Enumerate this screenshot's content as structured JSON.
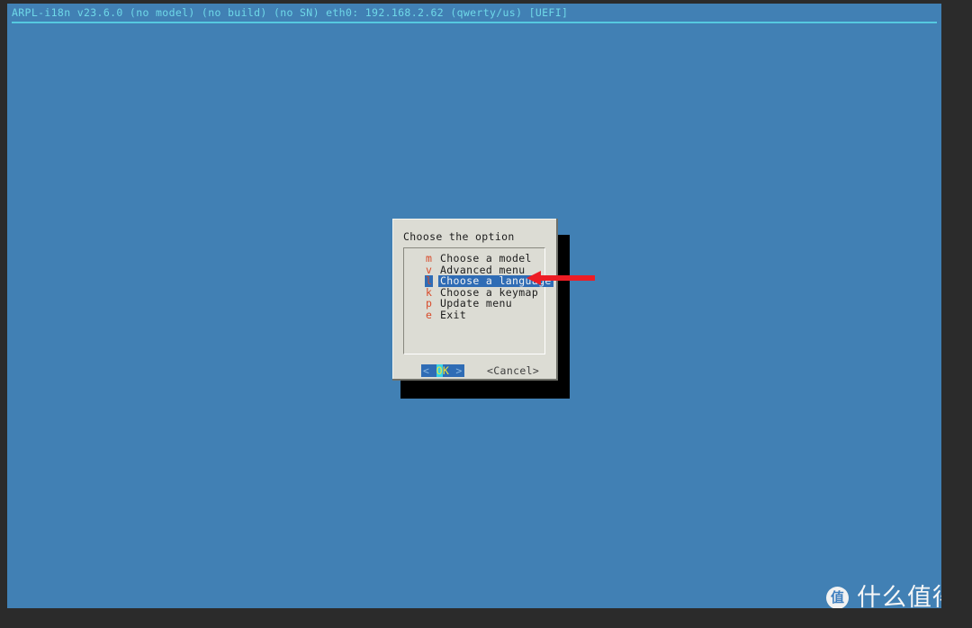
{
  "screen": {
    "background_color": "#2b2b2b",
    "console_color": "#4180b4"
  },
  "status_bar": {
    "text": "ARPL-i18n v23.6.0 (no model) (no build) (no SN) eth0: 192.168.2.62 (qwerty/us) [UEFI]",
    "text_color": "#6fd8e8",
    "rule_color": "#55c9e0"
  },
  "dialog": {
    "title": "Choose the option",
    "background_color": "#dcdcd4",
    "menu": {
      "items": [
        {
          "key": "m",
          "label": "Choose a model",
          "selected": false
        },
        {
          "key": "v",
          "label": "Advanced menu",
          "selected": false
        },
        {
          "key": "l",
          "label": "Choose a language",
          "selected": true
        },
        {
          "key": "k",
          "label": "Choose a keymap",
          "selected": false
        },
        {
          "key": "p",
          "label": "Update menu",
          "selected": false
        },
        {
          "key": "e",
          "label": "Exit",
          "selected": false
        }
      ],
      "key_color": "#d84a2a",
      "selection_color": "#2f6cb5"
    },
    "buttons": {
      "ok": {
        "left_bracket": "<",
        "hotkey": "O",
        "rest": "K",
        "right_bracket": ">",
        "focused": true
      },
      "cancel": {
        "label": "<Cancel>",
        "focused": false
      }
    }
  },
  "annotation": {
    "type": "arrow",
    "direction": "left",
    "color": "#ed1c24",
    "points_to": "Choose a language"
  },
  "watermark": {
    "logo_glyph": "值",
    "text": "什么值得买"
  }
}
